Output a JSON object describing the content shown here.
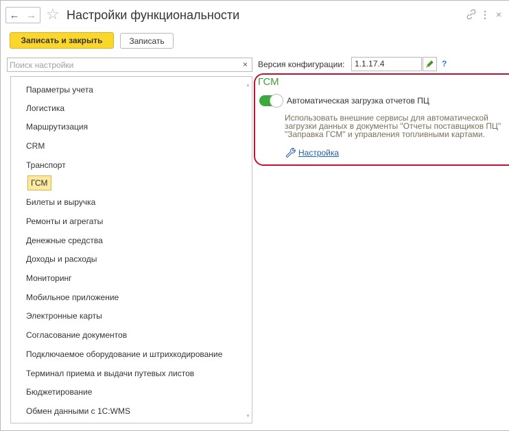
{
  "window": {
    "title": "Настройки функциональности",
    "back_icon": "←",
    "forward_icon": "→",
    "star_icon": "☆",
    "link_icon": "⇗",
    "more_icon": "⋮",
    "close_icon": "×"
  },
  "toolbar": {
    "save_close_label": "Записать и закрыть",
    "save_label": "Записать"
  },
  "search": {
    "placeholder": "Поиск настройки",
    "value": "",
    "clear_icon": "×"
  },
  "sidebar": {
    "items": [
      {
        "label": "Параметры учета"
      },
      {
        "label": "Логистика"
      },
      {
        "label": "Маршрутизация"
      },
      {
        "label": "CRM"
      },
      {
        "label": "Транспорт"
      },
      {
        "label": "ГСМ",
        "selected": true
      },
      {
        "label": "Билеты и выручка"
      },
      {
        "label": "Ремонты и агрегаты"
      },
      {
        "label": "Денежные средства"
      },
      {
        "label": "Доходы и расходы"
      },
      {
        "label": "Мониторинг"
      },
      {
        "label": "Мобильное приложение"
      },
      {
        "label": "Электронные карты"
      },
      {
        "label": "Согласование документов"
      },
      {
        "label": "Подключаемое оборудование и штрихкодирование"
      },
      {
        "label": "Терминал приема и выдачи путевых листов"
      },
      {
        "label": "Бюджетирование"
      },
      {
        "label": "Обмен данными с 1С:WMS"
      }
    ],
    "scroll_up_icon": "▲",
    "scroll_down_icon": "▼"
  },
  "config": {
    "version_label": "Версия конфигурации:",
    "version_value": "1.1.17.4",
    "help_label": "?"
  },
  "section": {
    "title": "ГСМ",
    "toggle_label": "Автоматическая загрузка отчетов ПЦ",
    "toggle_on": true,
    "description_lines": [
      "Использовать внешние сервисы для автоматической",
      "загрузки данных в документы \"Отчеты поставщиков ПЦ\"",
      "\"Заправка ГСМ\" и управления топливными картами."
    ],
    "setup_link": "Настройка"
  },
  "colors": {
    "primary_button": "#fbd72b",
    "selected_item": "#fbe9a2",
    "section_title": "#4a9b3a",
    "toggle_on": "#3aaa3a",
    "highlight_border": "#c8102e",
    "link": "#1f5fad"
  }
}
